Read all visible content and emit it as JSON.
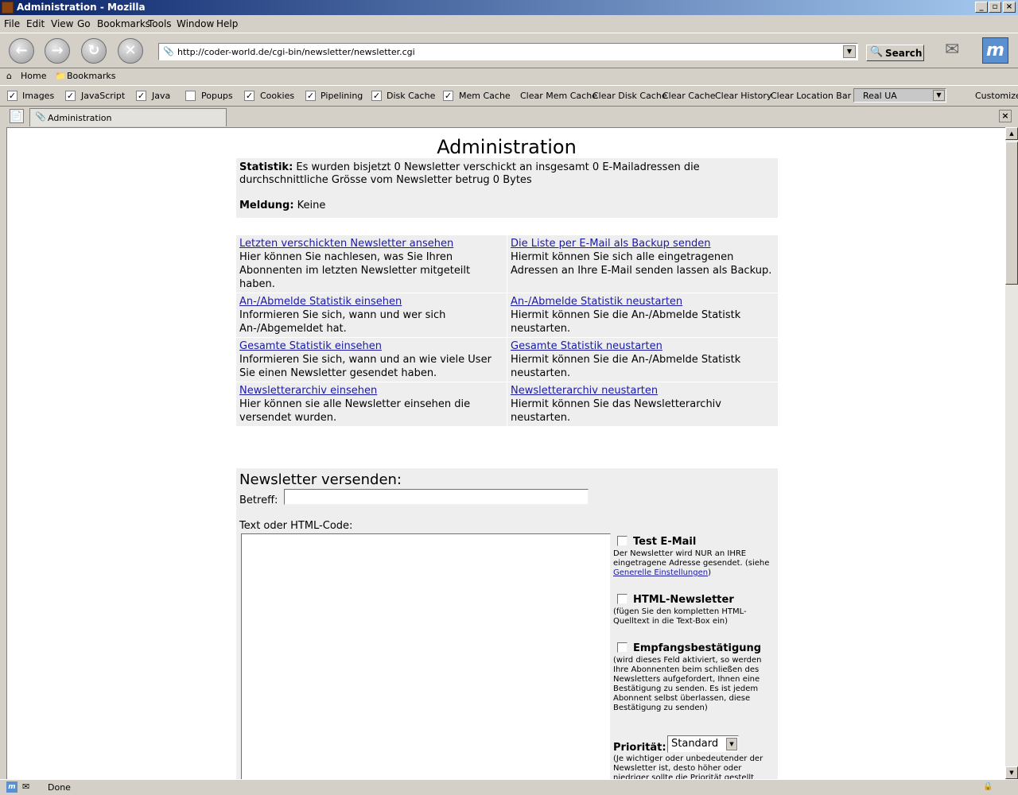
{
  "window": {
    "title": "Administration - Mozilla",
    "min": "_",
    "max": "▫",
    "close": "×"
  },
  "menu": [
    "File",
    "Edit",
    "View",
    "Go",
    "Bookmarks",
    "Tools",
    "Window",
    "Help"
  ],
  "nav": {
    "url": "http://coder-world.de/cgi-bin/newsletter/newsletter.cgi",
    "search_label": "Search"
  },
  "personal": {
    "home": "Home",
    "bookmarks": "Bookmarks"
  },
  "prefbar": {
    "checks": [
      {
        "label": "Images",
        "checked": true
      },
      {
        "label": "JavaScript",
        "checked": true
      },
      {
        "label": "Java",
        "checked": true
      },
      {
        "label": "Popups",
        "checked": false
      },
      {
        "label": "Cookies",
        "checked": true
      },
      {
        "label": "Pipelining",
        "checked": true
      },
      {
        "label": "Disk Cache",
        "checked": true
      },
      {
        "label": "Mem Cache",
        "checked": true
      }
    ],
    "buttons": [
      "Clear Mem Cache",
      "Clear Disk Cache",
      "Clear Cache",
      "Clear History",
      "Clear Location Bar"
    ],
    "ua": "Real UA",
    "customize": "Customize"
  },
  "tab": {
    "label": "Administration"
  },
  "page": {
    "title": "Administration",
    "stat_label": "Statistik:",
    "stat_text": "Es wurden bisjetzt 0 Newsletter verschickt an insgesamt 0 E-Mailadressen die durchschnittliche Grösse vom Newsletter betrug 0 Bytes",
    "msg_label": "Meldung:",
    "msg_text": "Keine",
    "links": [
      [
        {
          "link": "Letzten verschickten Newsletter ansehen",
          "desc": "Hier können Sie nachlesen, was Sie Ihren Abonnenten im letzten Newsletter mitgeteilt haben."
        },
        {
          "link": "Die Liste per E-Mail als Backup senden",
          "desc": "Hiermit können Sie sich alle eingetragenen Adressen an Ihre E-Mail senden lassen als Backup."
        }
      ],
      [
        {
          "link": "An-/Abmelde Statistik einsehen",
          "desc": "Informieren Sie sich, wann und wer sich An-/Abgemeldet hat."
        },
        {
          "link": "An-/Abmelde Statistik neustarten",
          "desc": "Hiermit können Sie die An-/Abmelde Statistk neustarten."
        }
      ],
      [
        {
          "link": "Gesamte Statistik einsehen",
          "desc": "Informieren Sie sich, wann und an wie viele User Sie einen Newsletter gesendet haben."
        },
        {
          "link": "Gesamte Statistik neustarten",
          "desc": "Hiermit können Sie die An-/Abmelde Statistk neustarten."
        }
      ],
      [
        {
          "link": "Newsletterarchiv einsehen",
          "desc": "Hier können sie alle Newsletter einsehen die versendet wurden."
        },
        {
          "link": "Newsletterarchiv neustarten",
          "desc": "Hiermit können Sie das Newsletterarchiv neustarten."
        }
      ]
    ],
    "send": {
      "title": "Newsletter versenden:",
      "subject_label": "Betreff:",
      "subject_value": "",
      "text_label": "Text oder HTML-Code:",
      "text_value": "",
      "opt_test_title": "Test E-Mail",
      "opt_test_desc": "Der Newsletter wird NUR an IHRE eingetragene Adresse gesendet. (siehe ",
      "opt_test_link": "Generelle Einstellungen",
      "opt_test_end": ")",
      "opt_html_title": "HTML-Newsletter",
      "opt_html_desc": "(fügen Sie den kompletten HTML-Quelltext in die Text-Box ein)",
      "opt_conf_title": "Empfangsbestätigung",
      "opt_conf_desc": "(wird dieses Feld aktiviert, so werden Ihre Abonnenten beim schließen des Newsletters aufgefordert, Ihnen eine Bestätigung zu senden. Es ist jedem Abonnent selbst überlassen, diese Bestätigung zu senden)",
      "prio_label": "Priorität:",
      "prio_value": "Standard",
      "prio_desc": "(Je wichtiger oder unbedeutender der Newsletter ist, desto höher oder niedriger sollte die Priorität gestellt"
    }
  },
  "status": {
    "text": "Done"
  }
}
